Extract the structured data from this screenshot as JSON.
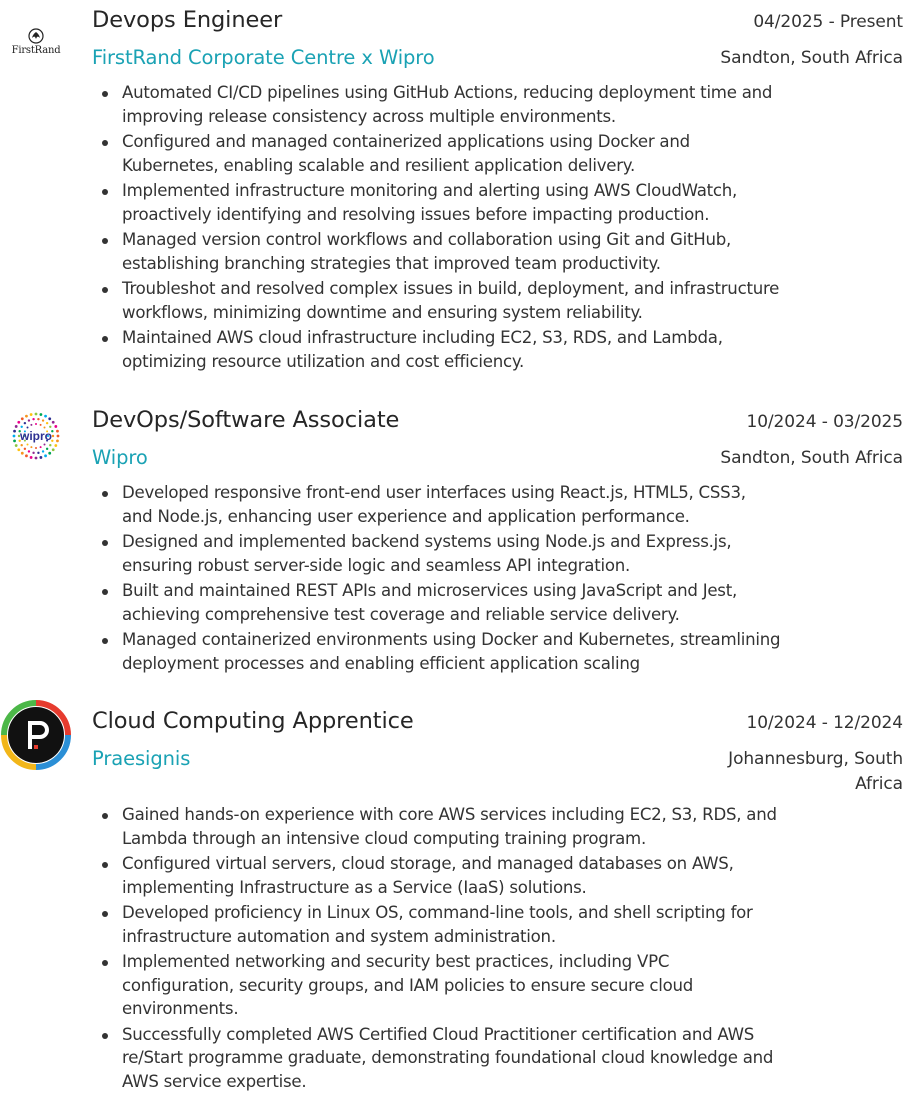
{
  "jobs": [
    {
      "title": "Devops Engineer",
      "dates": "04/2025 - Present",
      "company": "FirstRand Corporate Centre x Wipro",
      "location": "Sandton, South Africa",
      "logo_text": "FirstRand",
      "logo_icon": "firstrand-emblem-icon",
      "bullets": [
        [
          "Automated CI/CD pipelines using GitHub Actions, reducing deployment time and",
          "improving release consistency across multiple environments."
        ],
        [
          "Configured and managed containerized applications using Docker and",
          "Kubernetes, enabling scalable and resilient application delivery."
        ],
        [
          "Implemented infrastructure monitoring and alerting using AWS CloudWatch,",
          "proactively identifying and resolving issues before impacting production."
        ],
        [
          "Managed version control workflows and collaboration using Git and GitHub,",
          "establishing branching strategies that improved team productivity."
        ],
        [
          "Troubleshot and resolved complex issues in build, deployment, and infrastructure",
          "workflows, minimizing downtime and ensuring system reliability."
        ],
        [
          "Maintained AWS cloud infrastructure including EC2, S3, RDS, and Lambda,",
          "optimizing resource utilization and cost efficiency."
        ]
      ]
    },
    {
      "title": "DevOps/Software Associate",
      "dates": "10/2024 - 03/2025",
      "company": "Wipro",
      "location": "Sandton, South Africa",
      "logo_text": "wipro",
      "logo_icon": "wipro-dots-icon",
      "bullets": [
        [
          "Developed responsive front-end user interfaces using React.js, HTML5, CSS3,",
          "and Node.js, enhancing user experience and application performance."
        ],
        [
          "Designed and implemented backend systems using Node.js and Express.js,",
          "ensuring robust server-side logic and seamless API integration."
        ],
        [
          "Built and maintained REST APIs and microservices using JavaScript and Jest,",
          "achieving comprehensive test coverage and reliable service delivery."
        ],
        [
          "Managed containerized environments using Docker and Kubernetes, streamlining",
          "deployment processes and enabling efficient application scaling"
        ]
      ]
    },
    {
      "title": "Cloud Computing Apprentice",
      "dates": "10/2024 - 12/2024",
      "company": "Praesignis",
      "location_lines": [
        "Johannesburg, South",
        "Africa"
      ],
      "logo_icon": "praesignis-p-icon",
      "bullets": [
        [
          "Gained hands-on experience with core AWS services including EC2, S3, RDS, and",
          "Lambda through an intensive cloud computing training program."
        ],
        [
          "Configured virtual servers, cloud storage, and managed databases on AWS,",
          "implementing Infrastructure as a Service (IaaS) solutions."
        ],
        [
          "Developed proficiency in Linux OS, command-line tools, and shell scripting for",
          "infrastructure automation and system administration."
        ],
        [
          "Implemented networking and security best practices, including VPC",
          "configuration, security groups, and IAM policies to ensure secure cloud",
          "environments."
        ],
        [
          "Successfully completed AWS Certified Cloud Practitioner certification and AWS",
          "re/Start programme graduate, demonstrating foundational cloud knowledge and",
          "AWS service expertise."
        ]
      ]
    }
  ],
  "colors": {
    "accent": "#1aa2b4",
    "text": "#333333",
    "heading": "#262626"
  }
}
